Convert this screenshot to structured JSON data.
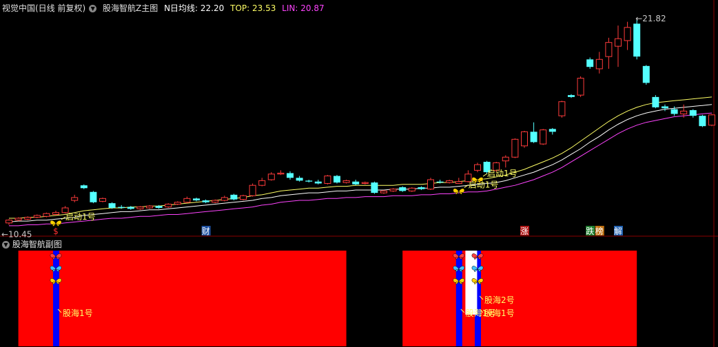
{
  "header": {
    "app_title": "视觉中国(日线 前复权)",
    "indicator_name": "股海智航Z主图",
    "ma_label": "N日均线: 22.20",
    "top_label": "TOP: 23.53",
    "lin_label": "LIN: 20.87"
  },
  "sub_header": {
    "title": "股海智航副图"
  },
  "colors": {
    "up": "#ff3b3b",
    "down": "#54ffff",
    "ma": "#ffff66",
    "top": "#ffffff",
    "lin": "#ff44ff",
    "grid": "#8b0000"
  },
  "chart_data": {
    "type": "candlestick",
    "y_range": [
      10.0,
      33.0
    ],
    "high_label": "21.82",
    "low_label": "10.45",
    "candles": [
      {
        "o": 10.6,
        "c": 10.9,
        "h": 11.0,
        "l": 10.4
      },
      {
        "o": 10.9,
        "c": 11.1,
        "h": 11.2,
        "l": 10.8
      },
      {
        "o": 11.0,
        "c": 11.2,
        "h": 11.3,
        "l": 10.9
      },
      {
        "o": 11.2,
        "c": 11.4,
        "h": 11.5,
        "l": 11.1
      },
      {
        "o": 11.3,
        "c": 11.6,
        "h": 11.7,
        "l": 11.2
      },
      {
        "o": 11.5,
        "c": 11.7,
        "h": 11.9,
        "l": 11.4
      },
      {
        "o": 11.7,
        "c": 12.2,
        "h": 12.4,
        "l": 11.6
      },
      {
        "o": 13.0,
        "c": 13.3,
        "h": 13.6,
        "l": 12.8
      },
      {
        "o": 14.6,
        "c": 14.3,
        "h": 14.7,
        "l": 14.2
      },
      {
        "o": 13.9,
        "c": 12.8,
        "h": 14.0,
        "l": 12.7
      },
      {
        "o": 12.9,
        "c": 13.2,
        "h": 13.3,
        "l": 12.8
      },
      {
        "o": 12.7,
        "c": 12.2,
        "h": 12.8,
        "l": 12.1
      },
      {
        "o": 12.3,
        "c": 12.2,
        "h": 12.5,
        "l": 12.1
      },
      {
        "o": 12.3,
        "c": 12.1,
        "h": 12.4,
        "l": 12.0
      },
      {
        "o": 12.1,
        "c": 12.3,
        "h": 12.4,
        "l": 12.0
      },
      {
        "o": 12.2,
        "c": 12.4,
        "h": 12.5,
        "l": 12.1
      },
      {
        "o": 12.4,
        "c": 12.2,
        "h": 12.5,
        "l": 12.1
      },
      {
        "o": 12.3,
        "c": 12.6,
        "h": 12.7,
        "l": 12.2
      },
      {
        "o": 12.6,
        "c": 12.8,
        "h": 12.9,
        "l": 12.5
      },
      {
        "o": 12.8,
        "c": 13.2,
        "h": 13.4,
        "l": 12.7
      },
      {
        "o": 13.2,
        "c": 13.0,
        "h": 13.3,
        "l": 12.9
      },
      {
        "o": 13.0,
        "c": 12.8,
        "h": 13.1,
        "l": 12.7
      },
      {
        "o": 12.8,
        "c": 13.0,
        "h": 13.1,
        "l": 12.7
      },
      {
        "o": 13.0,
        "c": 13.3,
        "h": 13.5,
        "l": 12.9
      },
      {
        "o": 13.6,
        "c": 13.1,
        "h": 13.7,
        "l": 13.0
      },
      {
        "o": 13.1,
        "c": 13.5,
        "h": 13.6,
        "l": 13.0
      },
      {
        "o": 13.5,
        "c": 14.6,
        "h": 14.8,
        "l": 13.4
      },
      {
        "o": 14.6,
        "c": 15.1,
        "h": 15.4,
        "l": 14.5
      },
      {
        "o": 15.2,
        "c": 15.8,
        "h": 16.0,
        "l": 15.1
      },
      {
        "o": 15.8,
        "c": 15.9,
        "h": 16.2,
        "l": 15.7
      },
      {
        "o": 15.9,
        "c": 15.4,
        "h": 16.1,
        "l": 15.2
      },
      {
        "o": 15.4,
        "c": 15.1,
        "h": 15.6,
        "l": 15.0
      },
      {
        "o": 15.1,
        "c": 15.0,
        "h": 15.2,
        "l": 14.9
      },
      {
        "o": 15.0,
        "c": 14.8,
        "h": 15.2,
        "l": 14.7
      },
      {
        "o": 14.8,
        "c": 15.6,
        "h": 15.7,
        "l": 14.7
      },
      {
        "o": 15.6,
        "c": 14.9,
        "h": 15.7,
        "l": 14.8
      },
      {
        "o": 14.9,
        "c": 15.1,
        "h": 15.2,
        "l": 14.8
      },
      {
        "o": 15.0,
        "c": 14.7,
        "h": 15.2,
        "l": 14.6
      },
      {
        "o": 14.8,
        "c": 14.9,
        "h": 15.0,
        "l": 14.7
      },
      {
        "o": 14.9,
        "c": 13.8,
        "h": 15.0,
        "l": 13.7
      },
      {
        "o": 13.8,
        "c": 14.0,
        "h": 14.1,
        "l": 13.7
      },
      {
        "o": 14.0,
        "c": 14.2,
        "h": 14.3,
        "l": 13.9
      },
      {
        "o": 14.4,
        "c": 14.0,
        "h": 14.5,
        "l": 13.9
      },
      {
        "o": 14.0,
        "c": 14.3,
        "h": 14.4,
        "l": 13.9
      },
      {
        "o": 14.4,
        "c": 14.2,
        "h": 14.5,
        "l": 14.1
      },
      {
        "o": 14.2,
        "c": 15.2,
        "h": 15.4,
        "l": 14.1
      },
      {
        "o": 15.0,
        "c": 14.9,
        "h": 15.2,
        "l": 14.8
      },
      {
        "o": 14.9,
        "c": 15.1,
        "h": 15.2,
        "l": 14.8
      },
      {
        "o": 14.8,
        "c": 15.0,
        "h": 15.4,
        "l": 14.8
      },
      {
        "o": 15.0,
        "c": 15.8,
        "h": 16.2,
        "l": 14.9
      },
      {
        "o": 16.2,
        "c": 16.8,
        "h": 17.0,
        "l": 16.0
      },
      {
        "o": 17.1,
        "c": 16.0,
        "h": 17.2,
        "l": 15.8
      },
      {
        "o": 16.2,
        "c": 17.0,
        "h": 17.1,
        "l": 16.0
      },
      {
        "o": 17.2,
        "c": 17.6,
        "h": 17.8,
        "l": 16.5
      },
      {
        "o": 17.6,
        "c": 19.5,
        "h": 19.6,
        "l": 17.5
      },
      {
        "o": 18.8,
        "c": 20.3,
        "h": 20.4,
        "l": 18.6
      },
      {
        "o": 20.3,
        "c": 19.2,
        "h": 21.3,
        "l": 19.1
      },
      {
        "o": 19.0,
        "c": 20.5,
        "h": 20.6,
        "l": 18.9
      },
      {
        "o": 20.6,
        "c": 20.3,
        "h": 20.7,
        "l": 20.0
      },
      {
        "o": 22.0,
        "c": 23.5,
        "h": 23.6,
        "l": 21.8
      },
      {
        "o": 24.2,
        "c": 24.0,
        "h": 24.3,
        "l": 23.9
      },
      {
        "o": 24.2,
        "c": 26.0,
        "h": 26.2,
        "l": 24.0
      },
      {
        "o": 28.0,
        "c": 27.2,
        "h": 28.2,
        "l": 27.0
      },
      {
        "o": 27.0,
        "c": 28.0,
        "h": 28.8,
        "l": 26.5
      },
      {
        "o": 28.3,
        "c": 29.8,
        "h": 30.3,
        "l": 27.0
      },
      {
        "o": 29.4,
        "c": 30.2,
        "h": 31.6,
        "l": 27.2
      },
      {
        "o": 30.0,
        "c": 31.4,
        "h": 32.0,
        "l": 29.0
      },
      {
        "o": 31.8,
        "c": 28.3,
        "h": 32.2,
        "l": 28.0
      },
      {
        "o": 27.3,
        "c": 25.5,
        "h": 27.4,
        "l": 25.3
      },
      {
        "o": 24.0,
        "c": 22.9,
        "h": 24.2,
        "l": 22.8
      },
      {
        "o": 23.0,
        "c": 22.8,
        "h": 23.2,
        "l": 22.5
      },
      {
        "o": 22.7,
        "c": 22.2,
        "h": 23.0,
        "l": 22.0
      },
      {
        "o": 22.2,
        "c": 22.5,
        "h": 23.2,
        "l": 21.8
      },
      {
        "o": 22.6,
        "c": 22.0,
        "h": 22.7,
        "l": 21.8
      },
      {
        "o": 22.0,
        "c": 20.9,
        "h": 22.1,
        "l": 20.8
      },
      {
        "o": 21.0,
        "c": 22.1,
        "h": 22.2,
        "l": 20.9
      }
    ],
    "lines": [
      {
        "name": "N日均线",
        "color": "#ffff66",
        "values": [
          11.1,
          11.1,
          11.2,
          11.2,
          11.3,
          11.4,
          11.5,
          11.7,
          11.9,
          12.0,
          12.1,
          12.2,
          12.2,
          12.3,
          12.3,
          12.4,
          12.4,
          12.5,
          12.6,
          12.7,
          12.8,
          12.9,
          13.0,
          13.1,
          13.2,
          13.3,
          13.5,
          13.6,
          13.8,
          14.0,
          14.1,
          14.2,
          14.3,
          14.3,
          14.4,
          14.5,
          14.5,
          14.6,
          14.6,
          14.6,
          14.6,
          14.6,
          14.7,
          14.7,
          14.7,
          14.8,
          14.9,
          14.9,
          15.0,
          15.1,
          15.2,
          15.3,
          15.5,
          15.7,
          16.0,
          16.3,
          16.7,
          17.1,
          17.5,
          18.0,
          18.6,
          19.3,
          20.0,
          20.7,
          21.4,
          22.0,
          22.5,
          22.9,
          23.2,
          23.4,
          23.5,
          23.6,
          23.7,
          23.8,
          23.9,
          24.0
        ]
      },
      {
        "name": "TOP",
        "color": "#ffffff",
        "values": [
          10.7,
          10.8,
          10.8,
          10.9,
          10.9,
          11.0,
          11.1,
          11.2,
          11.4,
          11.5,
          11.6,
          11.7,
          11.8,
          11.8,
          11.9,
          12.0,
          12.0,
          12.1,
          12.2,
          12.3,
          12.4,
          12.5,
          12.6,
          12.7,
          12.8,
          12.9,
          13.0,
          13.2,
          13.3,
          13.5,
          13.6,
          13.7,
          13.8,
          13.8,
          13.9,
          14.0,
          14.0,
          14.1,
          14.1,
          14.1,
          14.1,
          14.2,
          14.2,
          14.2,
          14.3,
          14.3,
          14.4,
          14.4,
          14.5,
          14.6,
          14.7,
          14.8,
          14.9,
          15.1,
          15.4,
          15.7,
          16.0,
          16.4,
          16.8,
          17.3,
          17.9,
          18.5,
          19.2,
          19.8,
          20.5,
          21.1,
          21.6,
          22.0,
          22.3,
          22.5,
          22.7,
          22.8,
          22.9,
          23.0,
          23.1,
          23.2
        ]
      },
      {
        "name": "LIN",
        "color": "#ff44ff",
        "values": [
          10.3,
          10.3,
          10.4,
          10.4,
          10.5,
          10.5,
          10.6,
          10.7,
          10.8,
          10.9,
          11.0,
          11.1,
          11.1,
          11.2,
          11.3,
          11.3,
          11.4,
          11.5,
          11.5,
          11.6,
          11.7,
          11.8,
          11.9,
          12.0,
          12.1,
          12.2,
          12.3,
          12.5,
          12.6,
          12.8,
          12.9,
          13.0,
          13.0,
          13.1,
          13.2,
          13.2,
          13.3,
          13.3,
          13.4,
          13.4,
          13.4,
          13.5,
          13.5,
          13.5,
          13.6,
          13.6,
          13.7,
          13.7,
          13.8,
          13.9,
          13.9,
          14.0,
          14.2,
          14.4,
          14.6,
          14.9,
          15.2,
          15.6,
          16.0,
          16.5,
          17.1,
          17.7,
          18.3,
          18.9,
          19.5,
          20.1,
          20.6,
          21.0,
          21.3,
          21.5,
          21.7,
          21.9,
          22.0,
          22.1,
          22.2,
          22.3
        ]
      }
    ],
    "signals": [
      {
        "index": 5,
        "text": "启动1号"
      },
      {
        "index": 48,
        "text": "启动1号"
      },
      {
        "index": 50,
        "text": "启动1号"
      }
    ],
    "bottom_markers": [
      {
        "index": 5,
        "text": "$",
        "color": "#ff3030",
        "bg": ""
      },
      {
        "index": 21,
        "text": "财",
        "color": "#ffffff",
        "bg": "#1e50a0"
      },
      {
        "index": 55,
        "text": "涨",
        "color": "#ffffff",
        "bg": "#b01818"
      },
      {
        "index": 62,
        "text": "跌",
        "color": "#ffffff",
        "bg": "#208030"
      },
      {
        "index": 63,
        "text": "榜",
        "color": "#ffffff",
        "bg": "#c07010"
      },
      {
        "index": 65,
        "text": "解",
        "color": "#ffffff",
        "bg": "#2060b0"
      }
    ],
    "sub": {
      "zones": [
        [
          1,
          36
        ],
        [
          42,
          67
        ]
      ],
      "blue_bars": [
        5,
        48,
        50
      ],
      "white_bars": [
        49
      ],
      "butterfly_columns": [
        {
          "index": 5,
          "colors": [
            "#ff4040",
            "#40c0ff",
            "#ffd000"
          ]
        },
        {
          "index": 48,
          "colors": [
            "#ff4040",
            "#40c0ff",
            "#ffd000"
          ]
        },
        {
          "index": 50,
          "colors": [
            "#ff4040",
            "#40c0ff",
            "#ffd000"
          ]
        }
      ],
      "labels": [
        {
          "index": 5,
          "text": "股海1号",
          "row": 1
        },
        {
          "index": 48,
          "text": "股海1号",
          "row": 1
        },
        {
          "index": 50,
          "text": "股海1号",
          "row": 1
        },
        {
          "index": 50,
          "text": "股海2号",
          "row": 0
        }
      ]
    }
  }
}
